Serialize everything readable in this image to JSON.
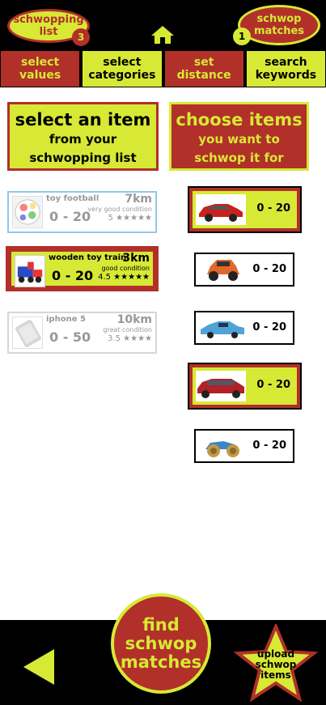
{
  "header": {
    "list_label": "schwopping\nlist",
    "list_count": "3",
    "matches_label": "schwop\nmatches",
    "matches_count": "1"
  },
  "tabs": [
    {
      "label": "select\nvalues"
    },
    {
      "label": "select\ncategories"
    },
    {
      "label": "set\ndistance"
    },
    {
      "label": "search\nkeywords"
    }
  ],
  "left_panel": {
    "heading": "select an item",
    "subheading": "from your\nschwopping list"
  },
  "right_panel": {
    "heading": "choose items",
    "subheading": "you want to\nschwop it for"
  },
  "items": [
    {
      "title": "toy football",
      "distance": "7km",
      "price": "0 - 20",
      "condition": "very good condition",
      "rating": "5"
    },
    {
      "title": "wooden toy train",
      "distance": "3km",
      "price": "0 - 20",
      "condition": "good condition",
      "rating": "4.5"
    },
    {
      "title": "iphone 5",
      "distance": "10km",
      "price": "0 - 50",
      "condition": "great condition",
      "rating": "3.5"
    }
  ],
  "offers": [
    {
      "price": "0 - 20"
    },
    {
      "price": "0 - 20"
    },
    {
      "price": "0 - 20"
    },
    {
      "price": "0 - 20"
    },
    {
      "price": "0 - 20"
    }
  ],
  "footer": {
    "find_label": "find\nschwop\nmatches",
    "upload_label": "upload\nschwop\nitems"
  },
  "colors": {
    "accent": "#d7e934",
    "brand": "#b1302a",
    "selected": "#4ba3e0"
  }
}
